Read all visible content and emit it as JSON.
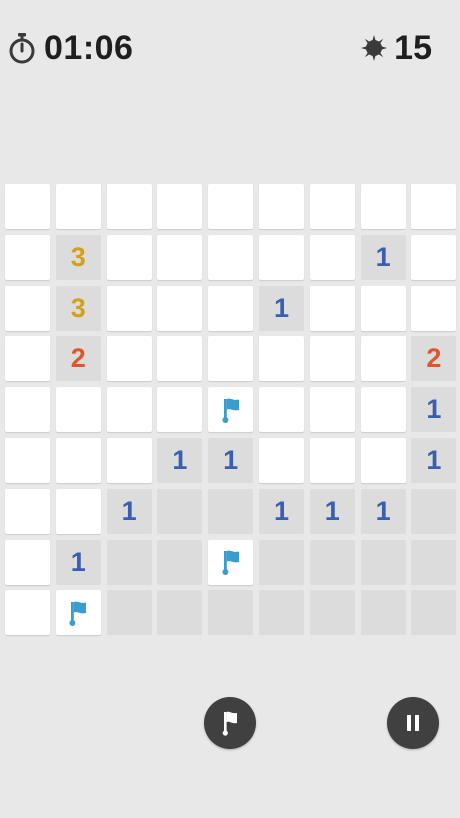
{
  "header": {
    "timer_icon": "stopwatch-icon",
    "timer": "01:06",
    "mines_icon": "mine-icon",
    "mines_remaining": "15"
  },
  "board": {
    "cols": 9,
    "rows": [
      [
        "c",
        "c",
        "c",
        "c",
        "c",
        "c",
        "c",
        "c",
        "c"
      ],
      [
        "c",
        "3",
        "c",
        "c",
        "c",
        "c",
        "c",
        "1",
        "c"
      ],
      [
        "c",
        "3",
        "c",
        "c",
        "c",
        "1",
        "c",
        "c",
        "c"
      ],
      [
        "c",
        "2",
        "c",
        "c",
        "c",
        "c",
        "c",
        "c",
        "2"
      ],
      [
        "c",
        "c",
        "c",
        "c",
        "F",
        "c",
        "c",
        "c",
        "1"
      ],
      [
        "c",
        "c",
        "c",
        "1",
        "1",
        "c",
        "c",
        "c",
        "1"
      ],
      [
        "c",
        "c",
        "1",
        "0",
        "0",
        "1",
        "1",
        "1",
        "0"
      ],
      [
        "c",
        "1",
        "0",
        "0",
        "F",
        "0",
        "0",
        "0",
        "0"
      ],
      [
        "c",
        "F",
        "0",
        "0",
        "0",
        "0",
        "0",
        "0",
        "0"
      ]
    ],
    "legend": {
      "c": "covered",
      "F": "flag",
      "0": "empty revealed"
    },
    "number_colors": {
      "1": "#3a5fb0",
      "2": "#e0552b",
      "3": "#d4a017"
    },
    "flag_color": "#3a9dd0"
  },
  "controls": {
    "flag_mode_icon": "flag-icon",
    "pause_icon": "pause-icon"
  }
}
